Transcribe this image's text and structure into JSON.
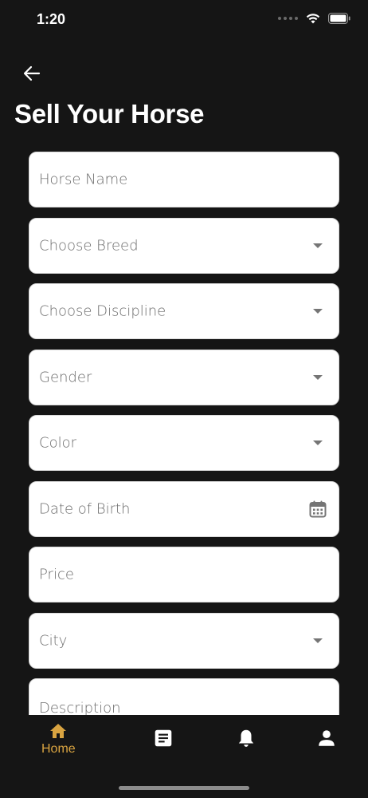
{
  "status_bar": {
    "time": "1:20"
  },
  "header": {
    "title": "Sell Your Horse"
  },
  "form": {
    "fields": [
      {
        "label": "Horse Name",
        "type": "text"
      },
      {
        "label": "Choose Breed",
        "type": "dropdown"
      },
      {
        "label": "Choose Discipline",
        "type": "dropdown"
      },
      {
        "label": "Gender",
        "type": "dropdown"
      },
      {
        "label": "Color",
        "type": "dropdown"
      },
      {
        "label": "Date of Birth",
        "type": "date"
      },
      {
        "label": "Price",
        "type": "text"
      },
      {
        "label": "City",
        "type": "dropdown"
      },
      {
        "label": "Description",
        "type": "textarea"
      }
    ]
  },
  "bottom_nav": {
    "items": [
      {
        "label": "Home",
        "icon": "home-icon",
        "active": true
      },
      {
        "label": "",
        "icon": "document-icon",
        "active": false
      },
      {
        "label": "",
        "icon": "bell-icon",
        "active": false
      },
      {
        "label": "",
        "icon": "person-icon",
        "active": false
      }
    ]
  },
  "colors": {
    "background": "#151515",
    "accent": "#d9a441",
    "field_background": "#ffffff",
    "placeholder_text": "#6b6b6b"
  }
}
